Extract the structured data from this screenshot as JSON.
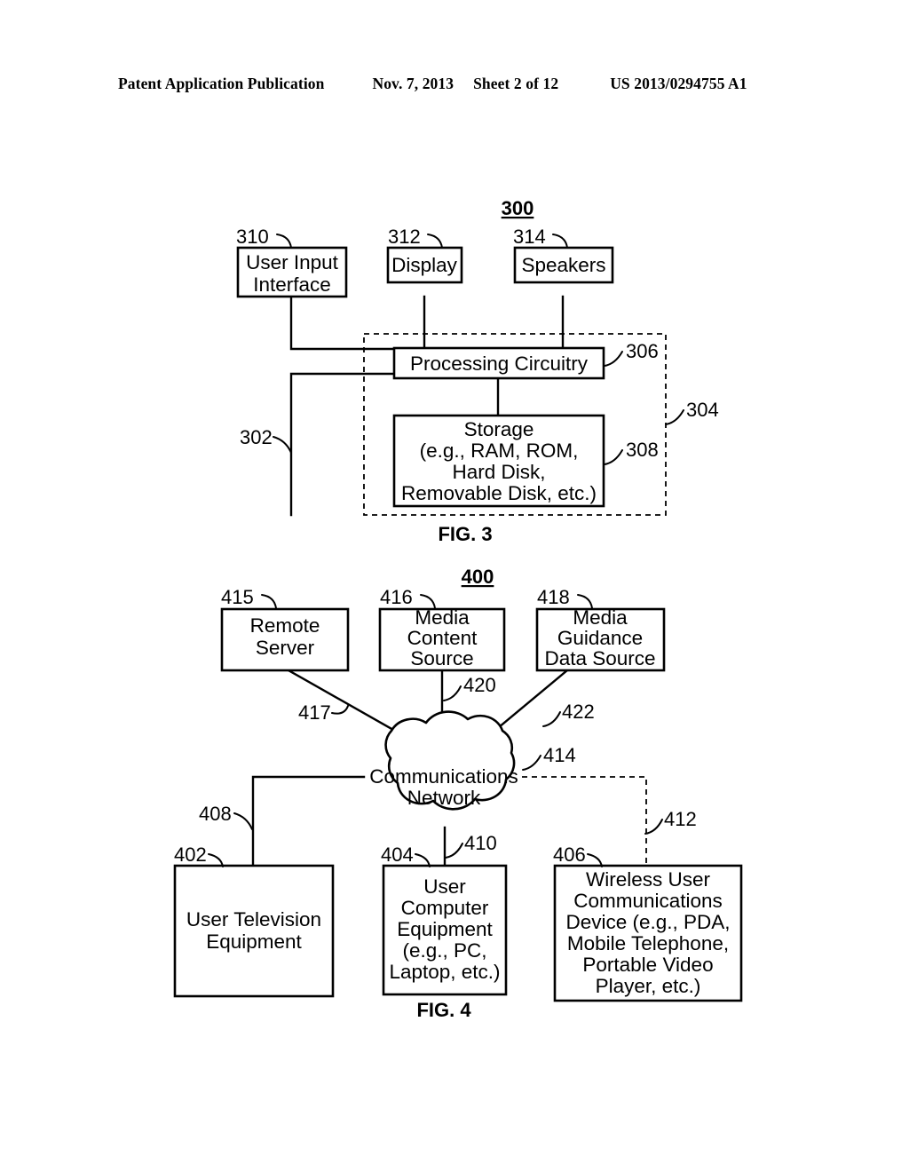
{
  "header": {
    "publication": "Patent Application Publication",
    "date": "Nov. 7, 2013",
    "sheet": "Sheet 2 of 12",
    "patent_number": "US 2013/0294755 A1"
  },
  "figures": [
    {
      "id": "fig3",
      "caption": "FIG. 3",
      "system_number": "300",
      "blocks": [
        {
          "ref": "310",
          "label_lines": [
            "User Input",
            "Interface"
          ]
        },
        {
          "ref": "312",
          "label_lines": [
            "Display"
          ]
        },
        {
          "ref": "314",
          "label_lines": [
            "Speakers"
          ]
        },
        {
          "ref": "306",
          "label_lines": [
            "Processing Circuitry"
          ]
        },
        {
          "ref": "308",
          "label_lines": [
            "Storage",
            "(e.g., RAM, ROM,",
            "Hard Disk,",
            "Removable Disk, etc.)"
          ]
        }
      ],
      "callouts": [
        {
          "ref": "302",
          "kind": "bus-line"
        },
        {
          "ref": "304",
          "kind": "dashed-enclosure"
        }
      ]
    },
    {
      "id": "fig4",
      "caption": "FIG. 4",
      "system_number": "400",
      "blocks": [
        {
          "ref": "415",
          "label_lines": [
            "Remote",
            "Server"
          ]
        },
        {
          "ref": "416",
          "label_lines": [
            "Media",
            "Content",
            "Source"
          ]
        },
        {
          "ref": "418",
          "label_lines": [
            "Media",
            "Guidance",
            "Data Source"
          ]
        },
        {
          "ref": "414",
          "label_lines": [
            "Communications",
            "Network"
          ]
        },
        {
          "ref": "402",
          "label_lines": [
            "User Television",
            "Equipment"
          ]
        },
        {
          "ref": "404",
          "label_lines": [
            "User",
            "Computer",
            "Equipment",
            "(e.g., PC,",
            "Laptop, etc.)"
          ]
        },
        {
          "ref": "406",
          "label_lines": [
            "Wireless User",
            "Communications",
            "Device (e.g., PDA,",
            "Mobile Telephone,",
            "Portable Video",
            "Player, etc.)"
          ]
        }
      ],
      "callouts": [
        {
          "ref": "417",
          "kind": "link"
        },
        {
          "ref": "420",
          "kind": "link"
        },
        {
          "ref": "422",
          "kind": "link"
        },
        {
          "ref": "408",
          "kind": "link"
        },
        {
          "ref": "410",
          "kind": "link"
        },
        {
          "ref": "412",
          "kind": "wireless-link"
        }
      ]
    }
  ],
  "text": {
    "fig3_caption": "FIG. 3",
    "fig4_caption": "FIG. 4",
    "n300": "300",
    "n302": "302",
    "n304": "304",
    "n306": "306",
    "n308": "308",
    "n310": "310",
    "n312": "312",
    "n314": "314",
    "n400": "400",
    "n402": "402",
    "n404": "404",
    "n406": "406",
    "n408": "408",
    "n410": "410",
    "n412": "412",
    "n414": "414",
    "n415": "415",
    "n416": "416",
    "n417": "417",
    "n418": "418",
    "n420": "420",
    "n422": "422",
    "user_input_l1": "User Input",
    "user_input_l2": "Interface",
    "display": "Display",
    "speakers": "Speakers",
    "processing_circuitry": "Processing Circuitry",
    "storage_l1": "Storage",
    "storage_l2": "(e.g., RAM, ROM,",
    "storage_l3": "Hard Disk,",
    "storage_l4": "Removable Disk, etc.)",
    "remote_server_l1": "Remote",
    "remote_server_l2": "Server",
    "media_content_l1": "Media",
    "media_content_l2": "Content",
    "media_content_l3": "Source",
    "media_guidance_l1": "Media",
    "media_guidance_l2": "Guidance",
    "media_guidance_l3": "Data Source",
    "comm_network_l1": "Communications",
    "comm_network_l2": "Network",
    "user_tv_l1": "User Television",
    "user_tv_l2": "Equipment",
    "user_comp_l1": "User",
    "user_comp_l2": "Computer",
    "user_comp_l3": "Equipment",
    "user_comp_l4": "(e.g., PC,",
    "user_comp_l5": "Laptop, etc.)",
    "wireless_l1": "Wireless User",
    "wireless_l2": "Communications",
    "wireless_l3": "Device (e.g., PDA,",
    "wireless_l4": "Mobile Telephone,",
    "wireless_l5": "Portable Video",
    "wireless_l6": "Player, etc.)"
  },
  "colors": {
    "ink": "#000000",
    "paper": "#ffffff"
  }
}
